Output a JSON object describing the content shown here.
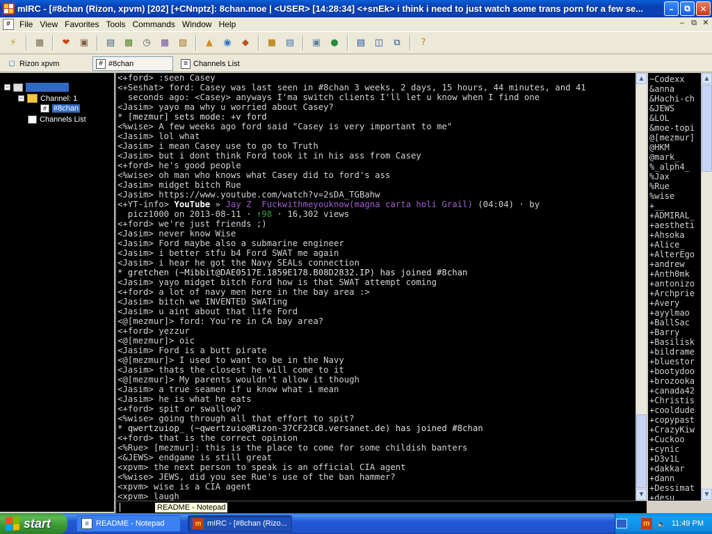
{
  "window": {
    "title": "mIRC - [#8chan (Rizon, xpvm) [202] [+CNnptz]: 8chan.moe | <USER> [14:28:34] <+snEk> i think i need to just watch some trans porn for a few se...",
    "minimize": "–",
    "maximize": "⧉",
    "close": "✕"
  },
  "menu": [
    "File",
    "View",
    "Favorites",
    "Tools",
    "Commands",
    "Window",
    "Help"
  ],
  "mdi_buttons": [
    "–",
    "⧉",
    "✕"
  ],
  "toolbar_icons": [
    "connect-icon",
    "options-icon",
    "favorites-icon",
    "address-book-icon",
    "notify-icon",
    "channels-list-icon",
    "timer-icon",
    "colors-icon",
    "scripts-editor-icon",
    "dcc-send-icon",
    "dcc-chat-icon",
    "dcc-options-icon",
    "received-files-icon",
    "logs-icon",
    "notify-list-icon",
    "urls-icon",
    "tile-horizontal-icon",
    "tile-vertical-icon",
    "cascade-icon",
    "help-icon"
  ],
  "switchbar": {
    "items": [
      {
        "label": "Rizon xpvm",
        "icon": "server-icon"
      },
      {
        "label": "#8chan",
        "icon": "channel-icon"
      },
      {
        "label": "Channels List",
        "icon": "list-icon"
      }
    ]
  },
  "tree": {
    "server": "",
    "channel_group": "Channel: 1",
    "channel": "#8chan",
    "channels_list": "Channels List"
  },
  "chat": {
    "lines": [
      {
        "text": "<+ford> :seen Casey"
      },
      {
        "text": "<+Seshat> ford: Casey was last seen in #8chan 3 weeks, 2 days, 15 hours, 44 minutes, and 41"
      },
      {
        "text": "  seconds ago: <Casey> anyways I'ma switch clients I'll let u know when I find one"
      },
      {
        "text": "<Jasim> yayo ma why u worried about Casey?"
      },
      {
        "text": "* [mezmur] sets mode: +v ford"
      },
      {
        "text": "<%wise> A few weeks ago ford said \"Casey is very important to me\""
      },
      {
        "text": "<Jasim> lol what"
      },
      {
        "text": "<Jasim> i mean Casey use to go to Truth"
      },
      {
        "text": "<Jasim> but i dont think Ford took it in his ass from Casey"
      },
      {
        "text": "<+ford> he's good people"
      },
      {
        "text": "<%wise> oh man who knows what Casey did to ford's ass"
      },
      {
        "text": "<Jasim> midget bitch Rue"
      },
      {
        "text": "<Jasim> https://www.youtube.com/watch?v=2sDA_TGBahw"
      },
      {
        "yt": true,
        "prefix": "<+YT-info> ",
        "brand": "YouTube",
        "sep": " » ",
        "song": "Jay Z  Fuckwithmeyouknow(magna carta holi Grail)",
        "rest": " (04:04) · by"
      },
      {
        "yt2": true,
        "prefix": "  picz1000 on 2013-08-11 · ",
        "likes": "↑",
        "likes_n": "98",
        "rest": " · 16,302 views"
      },
      {
        "text": "<+ford> we're just friends ;)"
      },
      {
        "text": "<Jasim> never know Wise"
      },
      {
        "text": "<Jasim> Ford maybe also a submarine engineer"
      },
      {
        "text": "<Jasim> i better stfu b4 Ford SWAT me again"
      },
      {
        "text": "<Jasim> i hear he got the Navy SEALs connection"
      },
      {
        "text": "* gretchen (~Mibbit@DAE0517E.1859E178.B08D2832.IP) has joined #8chan"
      },
      {
        "text": "<Jasim> yayo midget bitch Ford how is that SWAT attempt coming"
      },
      {
        "text": "<+ford> a lot of navy men here in the bay area :>"
      },
      {
        "text": "<Jasim> bitch we INVENTED SWATing"
      },
      {
        "text": "<Jasim> u aint about that life Ford"
      },
      {
        "text": "<@[mezmur]> ford: You're in CA bay area?"
      },
      {
        "text": "<+ford> yezzur"
      },
      {
        "text": "<@[mezmur]> oic"
      },
      {
        "text": "<Jasim> Ford is a butt pirate"
      },
      {
        "text": "<@[mezmur]> I used to want to be in the Navy"
      },
      {
        "text": "<Jasim> thats the closest he will come to it"
      },
      {
        "text": "<@[mezmur]> My parents wouldn't allow it though"
      },
      {
        "text": "<Jasim> a true seamen if u know what i mean"
      },
      {
        "text": "<Jasim> he is what he eats"
      },
      {
        "text": "<+ford> spit or swallow?"
      },
      {
        "text": "<%wise> going through all that effort to spit?"
      },
      {
        "text": "* qwertzuiop_ (~qwertzuio@Rizon-37CF23C8.versanet.de) has joined #8chan"
      },
      {
        "text": "<+ford> that is the correct opinion"
      },
      {
        "text": "<%Rue> [mezmur]: this is the place to come for some childish banters"
      },
      {
        "text": "<&JEWS> endgame is still great"
      },
      {
        "text": "<xpvm> the next person to speak is an official CIA agent"
      },
      {
        "text": "<%wise> JEWS, did you see Rue's use of the ban hammer?"
      },
      {
        "text": "<xpvm> wise is a CIA agent"
      },
      {
        "text": "<xpvm> laugh"
      }
    ]
  },
  "nicks": [
    "~Codexx",
    "&anna",
    "&Hachi-ch",
    "&JEWS",
    "&LOL",
    "&moe-topi",
    "@[mezmur]",
    "@HKM",
    "@mark_",
    "%_alph4_",
    "%Jax",
    "%Rue",
    "%wise",
    "+__",
    "+ADMIRAL_",
    "+aestheti",
    "+Ahsoka",
    "+Alice_",
    "+AlterEgo",
    "+andrew",
    "+Anth0mk",
    "+antonizo",
    "+Archprie",
    "+Avery",
    "+ayylmao",
    "+BallSac",
    "+Barry",
    "+Basilisk",
    "+bildrame",
    "+bluestor",
    "+bootydoo",
    "+brozooka",
    "+canada42",
    "+Christis",
    "+cooldude",
    "+copypast",
    "+CrazyKiw",
    "+Cuckoo",
    "+cynic",
    "+D3v1L",
    "+dakkar",
    "+dann",
    "+Dessimat",
    "+desu"
  ],
  "tooltip": "README - Notepad",
  "taskbar": {
    "start": "start",
    "tasks": [
      {
        "label": "README - Notepad",
        "icon": "notepad-icon"
      },
      {
        "label": "mIRC - [#8chan (Rizo...",
        "icon": "mirc-icon"
      }
    ],
    "clock": "11:49 PM"
  },
  "colors": {
    "chat_bg": "#000000",
    "chat_text": "#d2d2d2",
    "youtube_song": "#9f5fcf",
    "likes": "#3fa03f",
    "titlebar": "#0a3fb0",
    "taskbar": "#2157d7",
    "start": "#3a9a35"
  }
}
